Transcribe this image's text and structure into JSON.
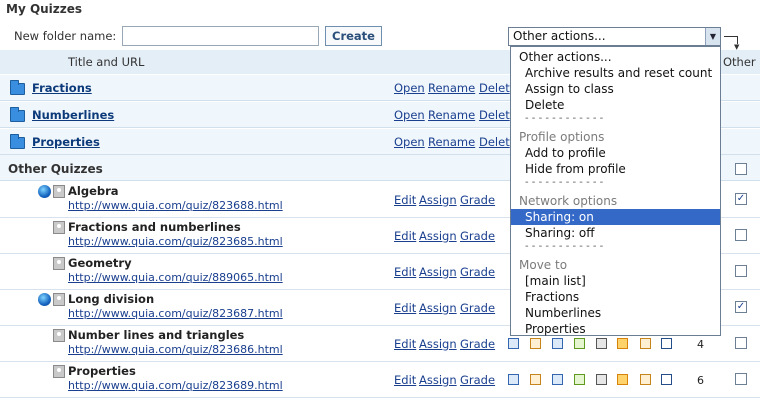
{
  "page": {
    "title": "My Quizzes"
  },
  "toolbar": {
    "folder_label": "New folder name:",
    "folder_input_value": "",
    "create_label": "Create",
    "actions_selected": "Other actions..."
  },
  "table": {
    "col_title": "Title and URL",
    "col_other": "Other"
  },
  "folders": [
    {
      "name": "Fractions",
      "open": "Open",
      "rename": "Rename",
      "delete": "Delet"
    },
    {
      "name": "Numberlines",
      "open": "Open",
      "rename": "Rename",
      "delete": "Delet"
    },
    {
      "name": "Properties",
      "open": "Open",
      "rename": "Rename",
      "delete": "Delet"
    }
  ],
  "section": {
    "title": "Other Quizzes"
  },
  "quizzes": [
    {
      "title": "Algebra",
      "url": "http://www.quia.com/quiz/823688.html",
      "shared": true,
      "checked": true,
      "count": ""
    },
    {
      "title": "Fractions and numberlines",
      "url": "http://www.quia.com/quiz/823685.html",
      "shared": false,
      "checked": false,
      "count": ""
    },
    {
      "title": "Geometry",
      "url": "http://www.quia.com/quiz/889065.html",
      "shared": false,
      "checked": false,
      "count": ""
    },
    {
      "title": "Long division",
      "url": "http://www.quia.com/quiz/823687.html",
      "shared": true,
      "checked": true,
      "count": ""
    },
    {
      "title": "Number lines and triangles",
      "url": "http://www.quia.com/quiz/823686.html",
      "shared": false,
      "checked": false,
      "count": "4"
    },
    {
      "title": "Properties",
      "url": "http://www.quia.com/quiz/823689.html",
      "shared": false,
      "checked": false,
      "count": "6"
    }
  ],
  "row_actions": {
    "edit": "Edit",
    "assign": "Assign",
    "grade": "Grade"
  },
  "dropdown": {
    "header": "Other actions...",
    "items": [
      "Archive results and reset count",
      "Assign to class",
      "Delete"
    ],
    "separator": "- - - - - - - - - - - -",
    "group_profile": "Profile options",
    "profile_items": [
      "Add to profile",
      "Hide from profile"
    ],
    "group_network": "Network options",
    "network_items": [
      "Sharing: on",
      "Sharing: off"
    ],
    "group_move": "Move to",
    "move_items": [
      "[main list]",
      "Fractions",
      "Numberlines",
      "Properties"
    ]
  },
  "colors": {
    "accent": "#3569c8",
    "header_bg": "#e4eef7",
    "row_bg": "#f0f7fc",
    "link": "#1a3f8f"
  }
}
